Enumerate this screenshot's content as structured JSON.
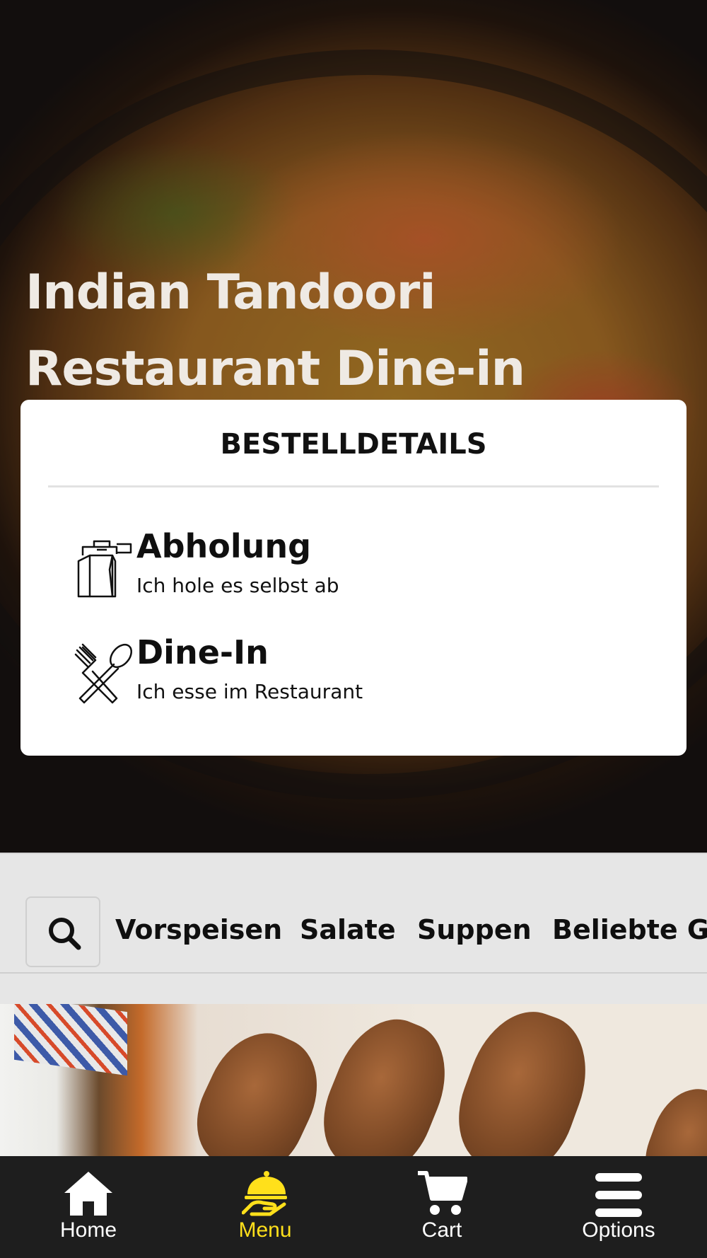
{
  "hero": {
    "title_line1": "Indian Tandoori",
    "title_line2": "Restaurant Dine-in"
  },
  "order_details": {
    "title": "BESTELLDETAILS",
    "options": [
      {
        "icon": "takeaway-bag-icon",
        "title": "Abholung",
        "subtitle": "Ich hole es selbst ab"
      },
      {
        "icon": "fork-spoon-icon",
        "title": "Dine-In",
        "subtitle": "Ich esse im Restaurant"
      }
    ]
  },
  "categories": {
    "search_icon": "search-icon",
    "items": [
      "Vorspeisen",
      "Salate",
      "Suppen",
      "Beliebte Ge"
    ]
  },
  "bottom_nav": {
    "items": [
      {
        "icon": "home-icon",
        "label": "Home",
        "active": false
      },
      {
        "icon": "cloche-hand-icon",
        "label": "Menu",
        "active": true
      },
      {
        "icon": "cart-icon",
        "label": "Cart",
        "active": false
      },
      {
        "icon": "hamburger-menu-icon",
        "label": "Options",
        "active": false
      }
    ]
  },
  "colors": {
    "nav_background": "#1e1e1e",
    "nav_active": "#ffe01b",
    "card_background": "#ffffff",
    "category_bar": "#e6e6e6"
  }
}
